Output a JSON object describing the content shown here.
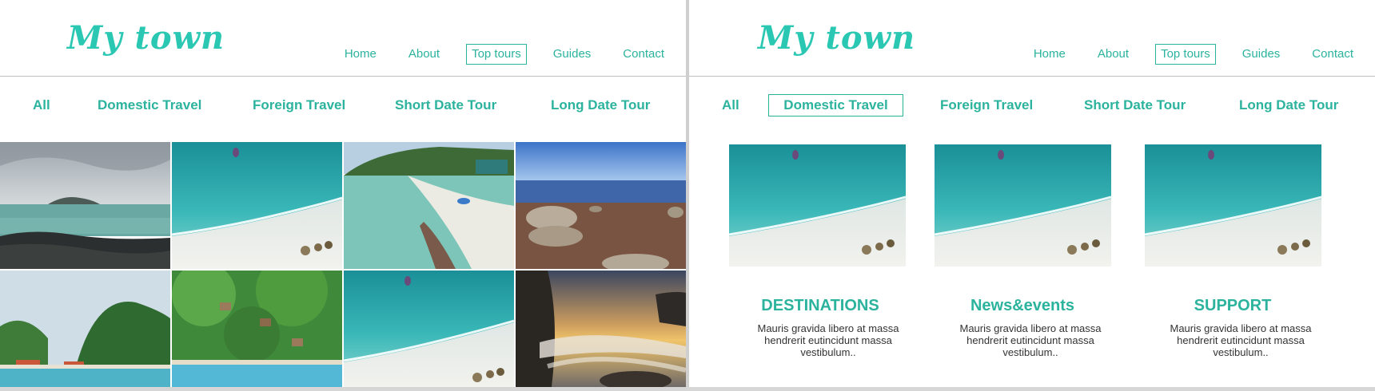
{
  "brand": {
    "logo_text": "My town",
    "accent": "#2ac7b3",
    "text_accent": "#2bb39d"
  },
  "nav": [
    "Home",
    "About",
    "Top tours",
    "Guides",
    "Contact"
  ],
  "filters": [
    "All",
    "Domestic Travel",
    "Foreign Travel",
    "Short Date Tour",
    "Long Date Tour"
  ],
  "left_panel": {
    "active_nav": "Top tours",
    "active_filter": "",
    "gallery": [
      {
        "scene": "rocky-coast-overcast"
      },
      {
        "scene": "beach-aerial-boat"
      },
      {
        "scene": "tropical-bay-rocks"
      },
      {
        "scene": "rocky-shore-blue-sky"
      },
      {
        "scene": "beach-village-hills"
      },
      {
        "scene": "jungle-hill-huts"
      },
      {
        "scene": "beach-aerial-boat"
      },
      {
        "scene": "sunset-waves-rocks"
      }
    ]
  },
  "right_panel": {
    "active_nav": "Top tours",
    "active_filter": "Domestic Travel",
    "cards": [
      {
        "title": "DESTINATIONS",
        "text": "Mauris gravida libero at massa hendrerit eutincidunt massa vestibulum.."
      },
      {
        "title": "News&events",
        "text": "Mauris gravida libero at massa hendrerit eutincidunt massa vestibulum.."
      },
      {
        "title": "SUPPORT",
        "text": "Mauris gravida libero at massa hendrerit eutincidunt massa vestibulum.."
      }
    ]
  }
}
